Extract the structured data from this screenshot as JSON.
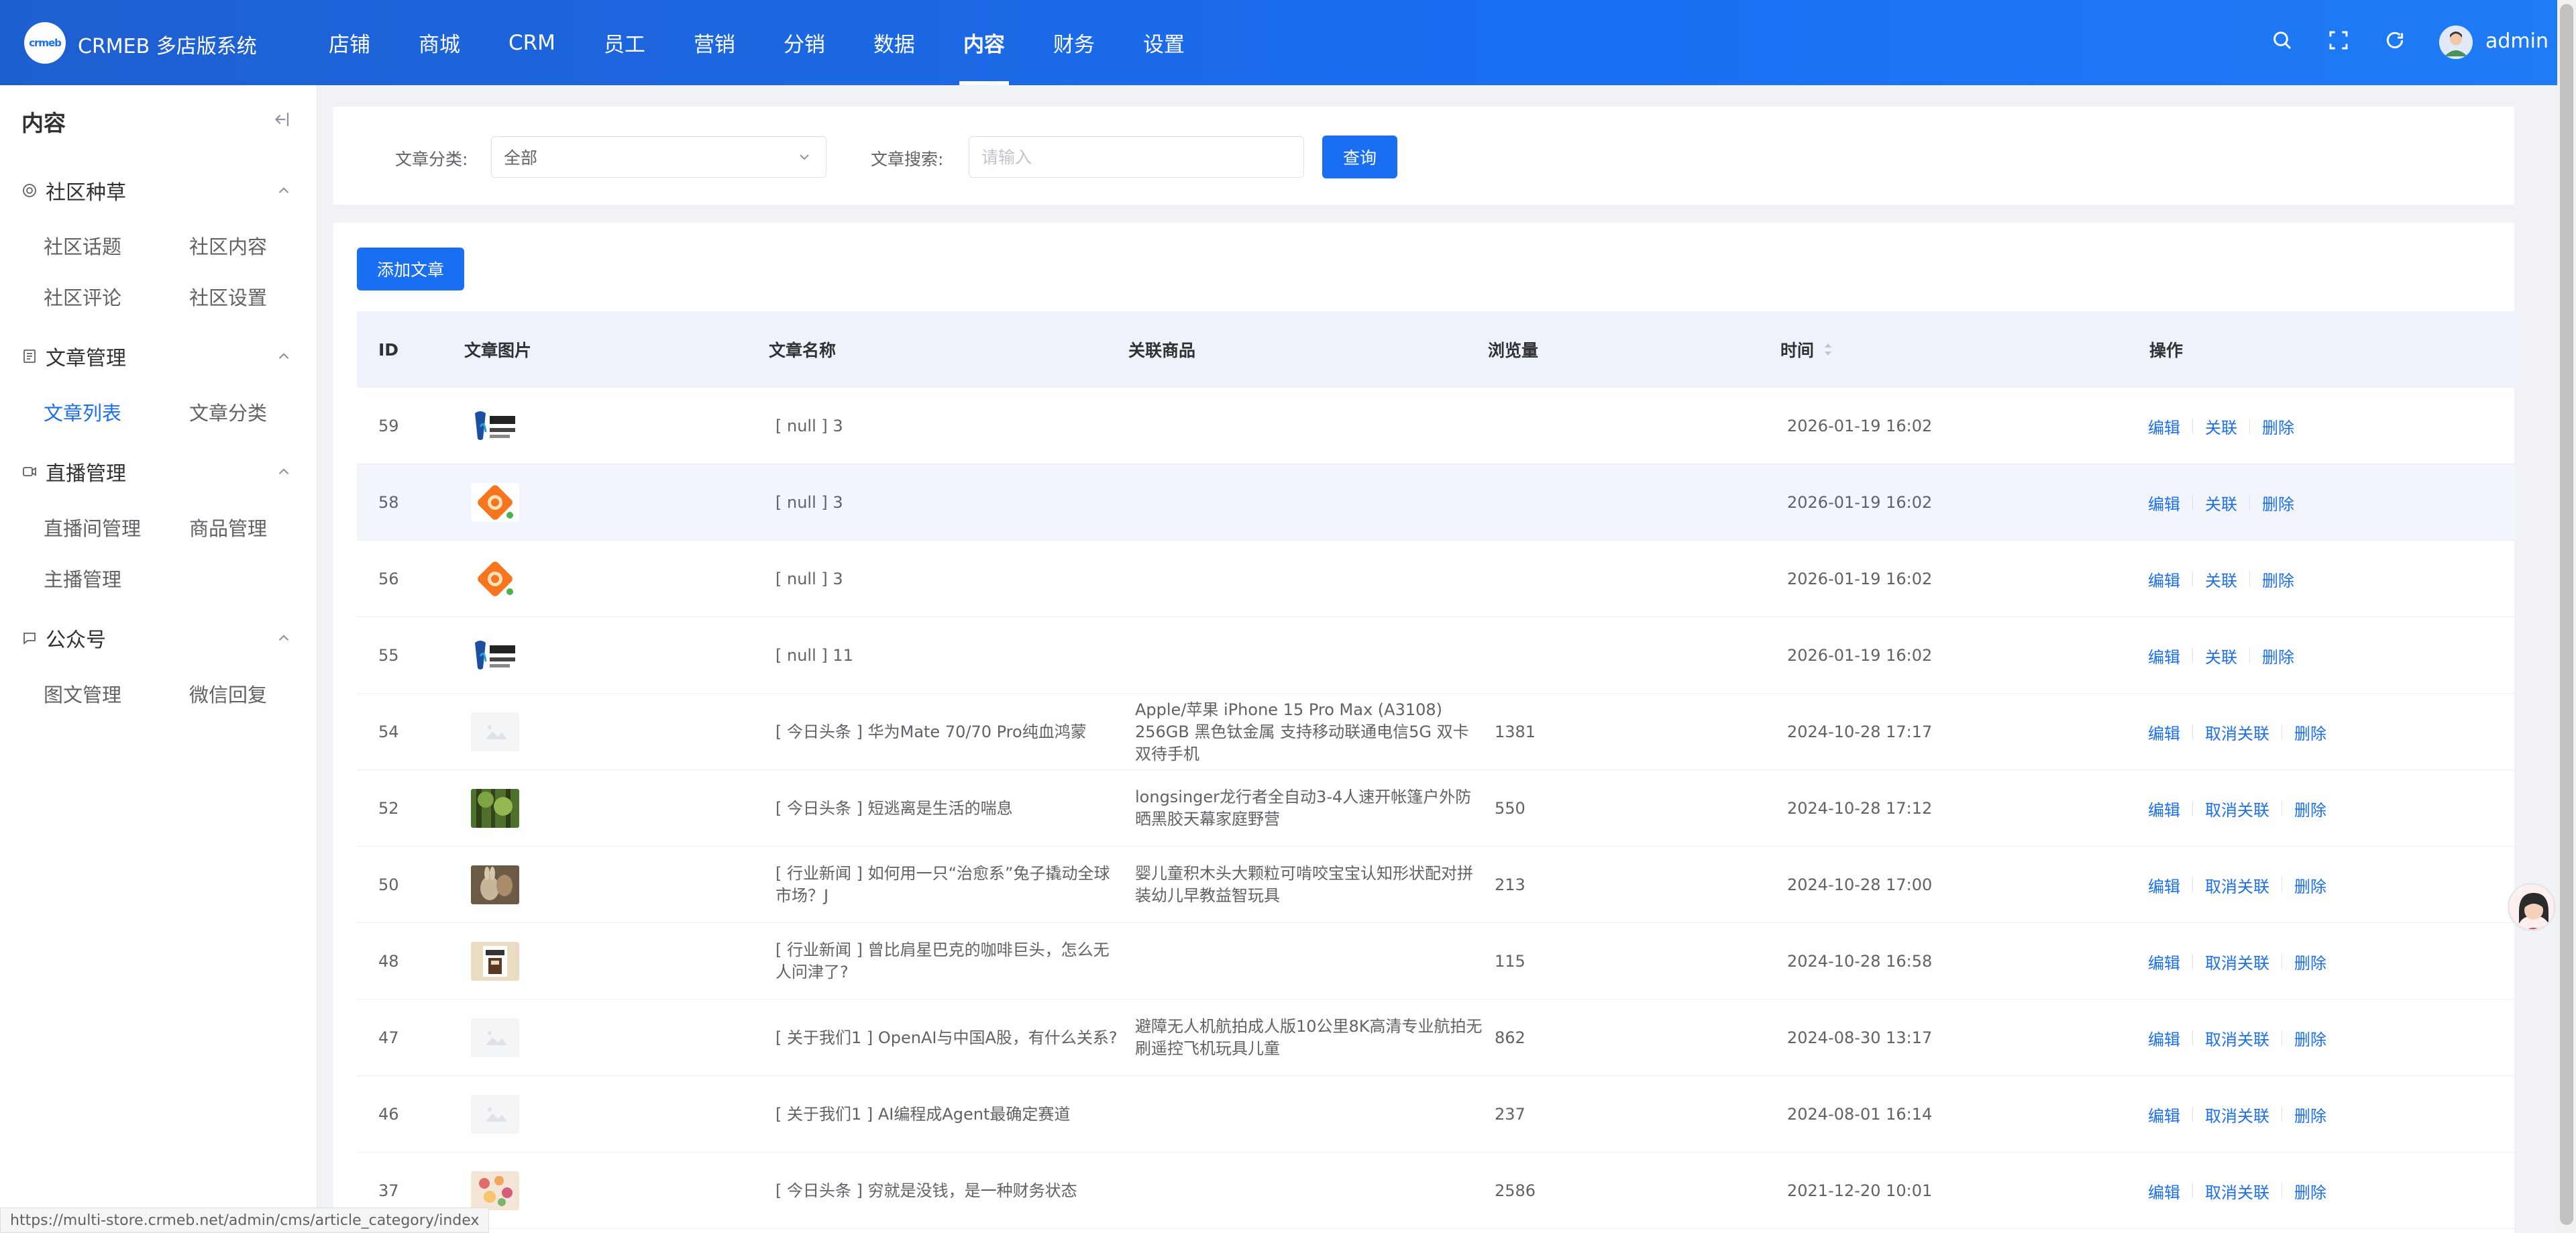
{
  "app": {
    "brand": "CRMEB 多店版系统",
    "logo_text": "crmeb",
    "user": "admin"
  },
  "topnav": [
    "店铺",
    "商城",
    "CRM",
    "员工",
    "营销",
    "分销",
    "数据",
    "内容",
    "财务",
    "设置"
  ],
  "topnav_active": "内容",
  "sidebar": {
    "title": "内容",
    "groups": [
      {
        "label": "社区种草",
        "items": [
          "社区话题",
          "社区内容",
          "社区评论",
          "社区设置"
        ]
      },
      {
        "label": "文章管理",
        "items": [
          "文章列表",
          "文章分类"
        ]
      },
      {
        "label": "直播管理",
        "items": [
          "直播间管理",
          "商品管理",
          "主播管理"
        ]
      },
      {
        "label": "公众号",
        "items": [
          "图文管理",
          "微信回复"
        ]
      }
    ],
    "active_item": "文章列表"
  },
  "filter": {
    "category_label": "文章分类:",
    "category_value": "全部",
    "search_label": "文章搜索:",
    "search_placeholder": "请输入",
    "query_button": "查询"
  },
  "add_button": "添加文章",
  "table": {
    "headers": [
      "ID",
      "文章图片",
      "文章名称",
      "关联商品",
      "浏览量",
      "时间",
      "操作"
    ],
    "rows": [
      {
        "id": "59",
        "img": "logo-bank",
        "name": "[ null ] 3",
        "product": "",
        "views": "",
        "time": "2026-01-19 16:02",
        "ops": [
          "编辑",
          "关联",
          "删除"
        ]
      },
      {
        "id": "58",
        "img": "orange-app",
        "name": "[ null ] 3",
        "product": "",
        "views": "",
        "time": "2026-01-19 16:02",
        "ops": [
          "编辑",
          "关联",
          "删除"
        ]
      },
      {
        "id": "56",
        "img": "orange-app",
        "name": "[ null ] 3",
        "product": "",
        "views": "",
        "time": "2026-01-19 16:02",
        "ops": [
          "编辑",
          "关联",
          "删除"
        ]
      },
      {
        "id": "55",
        "img": "logo-bank",
        "name": "[ null ] 11",
        "product": "",
        "views": "",
        "time": "2026-01-19 16:02",
        "ops": [
          "编辑",
          "关联",
          "删除"
        ]
      },
      {
        "id": "54",
        "img": "placeholder",
        "name": "[ 今日头条 ] 华为Mate 70/70 Pro纯血鸿蒙",
        "product": "Apple/苹果 iPhone 15 Pro Max (A3108) 256GB 黑色钛金属 支持移动联通电信5G 双卡双待手机",
        "views": "1381",
        "time": "2024-10-28 17:17",
        "ops": [
          "编辑",
          "取消关联",
          "删除"
        ]
      },
      {
        "id": "52",
        "img": "forest",
        "name": "[ 今日头条 ] 短逃离是生活的喘息",
        "product": "longsinger龙行者全自动3-4人速开帐篷户外防晒黑胶天幕家庭野营",
        "views": "550",
        "time": "2024-10-28 17:12",
        "ops": [
          "编辑",
          "取消关联",
          "删除"
        ]
      },
      {
        "id": "50",
        "img": "rabbit",
        "name": "[ 行业新闻 ] 如何用一只“治愈系”兔子撬动全球市场？J",
        "product": "婴儿童积木头大颗粒可啃咬宝宝认知形状配对拼装幼儿早教益智玩具",
        "views": "213",
        "time": "2024-10-28 17:00",
        "ops": [
          "编辑",
          "取消关联",
          "删除"
        ]
      },
      {
        "id": "48",
        "img": "coffee",
        "name": "[ 行业新闻 ] 曾比肩星巴克的咖啡巨头，怎么无人问津了?",
        "product": "",
        "views": "115",
        "time": "2024-10-28 16:58",
        "ops": [
          "编辑",
          "取消关联",
          "删除"
        ]
      },
      {
        "id": "47",
        "img": "placeholder",
        "name": "[ 关于我们1 ] OpenAI与中国A股，有什么关系?",
        "product": "避障无人机航拍成人版10公里8K高清专业航拍无刷遥控飞机玩具儿童",
        "views": "862",
        "time": "2024-08-30 13:17",
        "ops": [
          "编辑",
          "取消关联",
          "删除"
        ]
      },
      {
        "id": "46",
        "img": "placeholder",
        "name": "[ 关于我们1 ] AI编程成Agent最确定赛道",
        "product": "",
        "views": "237",
        "time": "2024-08-01 16:14",
        "ops": [
          "编辑",
          "取消关联",
          "删除"
        ]
      },
      {
        "id": "37",
        "img": "flowers",
        "name": "[ 今日头条 ] 穷就是没钱，是一种财务状态",
        "product": "",
        "views": "2586",
        "time": "2021-12-20 10:01",
        "ops": [
          "编辑",
          "取消关联",
          "删除"
        ]
      }
    ]
  },
  "status_url": "https://multi-store.crmeb.net/admin/cms/article_category/index",
  "colors": {
    "primary": "#1a6ef2",
    "header_start": "#1e5fd0",
    "header_end": "#1f7cf5"
  }
}
